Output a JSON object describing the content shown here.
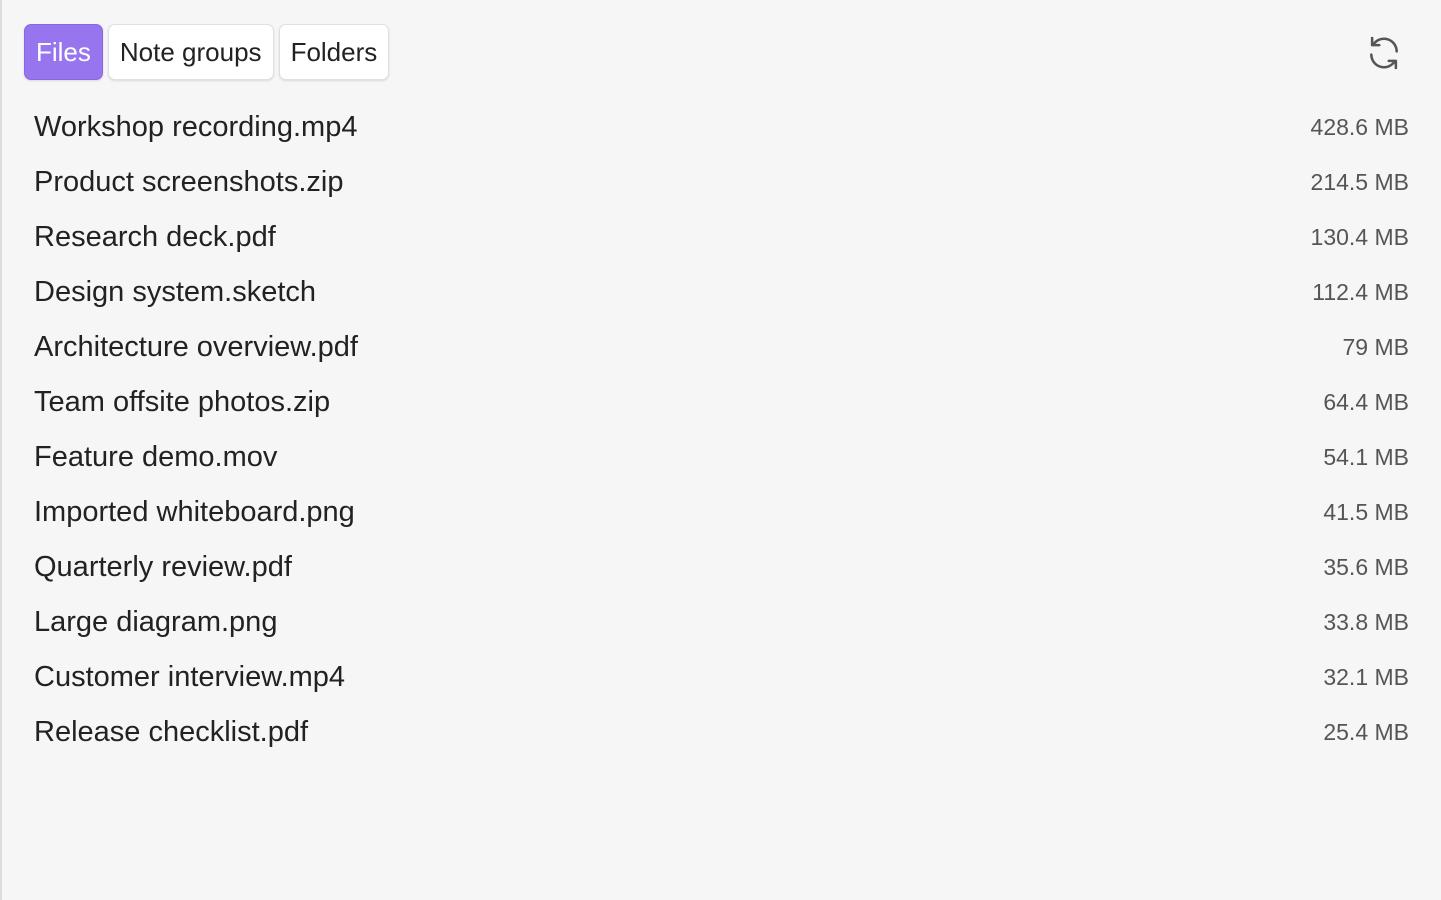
{
  "tabs": [
    {
      "label": "Files",
      "active": true
    },
    {
      "label": "Note groups",
      "active": false
    },
    {
      "label": "Folders",
      "active": false
    }
  ],
  "toolbar": {
    "refresh_icon": "refresh-icon"
  },
  "colors": {
    "accent": "#9775ee",
    "background": "#f6f6f6",
    "text": "#222222",
    "muted": "#555555"
  },
  "files": [
    {
      "name": "Workshop recording.mp4",
      "size": "428.6 MB"
    },
    {
      "name": "Product screenshots.zip",
      "size": "214.5 MB"
    },
    {
      "name": "Research deck.pdf",
      "size": "130.4 MB"
    },
    {
      "name": "Design system.sketch",
      "size": "112.4 MB"
    },
    {
      "name": "Architecture overview.pdf",
      "size": "79 MB"
    },
    {
      "name": "Team offsite photos.zip",
      "size": "64.4 MB"
    },
    {
      "name": "Feature demo.mov",
      "size": "54.1 MB"
    },
    {
      "name": "Imported whiteboard.png",
      "size": "41.5 MB"
    },
    {
      "name": "Quarterly review.pdf",
      "size": "35.6 MB"
    },
    {
      "name": "Large diagram.png",
      "size": "33.8 MB"
    },
    {
      "name": "Customer interview.mp4",
      "size": "32.1 MB"
    },
    {
      "name": "Release checklist.pdf",
      "size": "25.4 MB"
    }
  ]
}
